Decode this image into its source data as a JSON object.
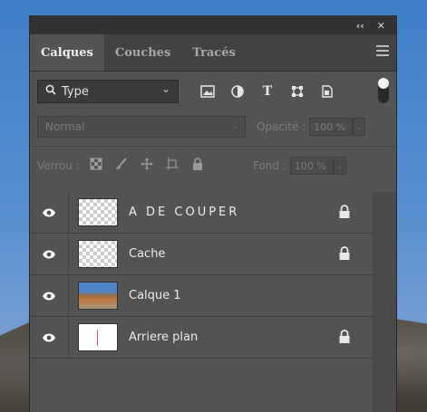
{
  "window": {
    "collapse_glyph": "‹‹",
    "close_glyph": "✕"
  },
  "tabs": [
    {
      "label": "Calques",
      "active": true
    },
    {
      "label": "Couches",
      "active": false
    },
    {
      "label": "Tracés",
      "active": false
    }
  ],
  "filter": {
    "type_label": "Type",
    "text_filter_glyph": "T"
  },
  "blend": {
    "mode": "Normal",
    "opacity_label": "Opacité :",
    "opacity_value": "100 %"
  },
  "lock": {
    "label": "Verrou :",
    "fill_label": "Fond :",
    "fill_value": "100 %"
  },
  "layers": [
    {
      "name": "A DE COUPER",
      "thumbnail": "transparent",
      "locked": true
    },
    {
      "name": "Cache",
      "thumbnail": "transparent",
      "locked": true
    },
    {
      "name": "Calque 1",
      "thumbnail": "photo",
      "locked": false
    },
    {
      "name": "Arriere plan",
      "thumbnail": "white",
      "locked": true
    }
  ],
  "colors": {
    "panel_bg": "#535353",
    "tab_bar_bg": "#424242",
    "titlebar_bg": "#323232",
    "text": "#ececec"
  }
}
